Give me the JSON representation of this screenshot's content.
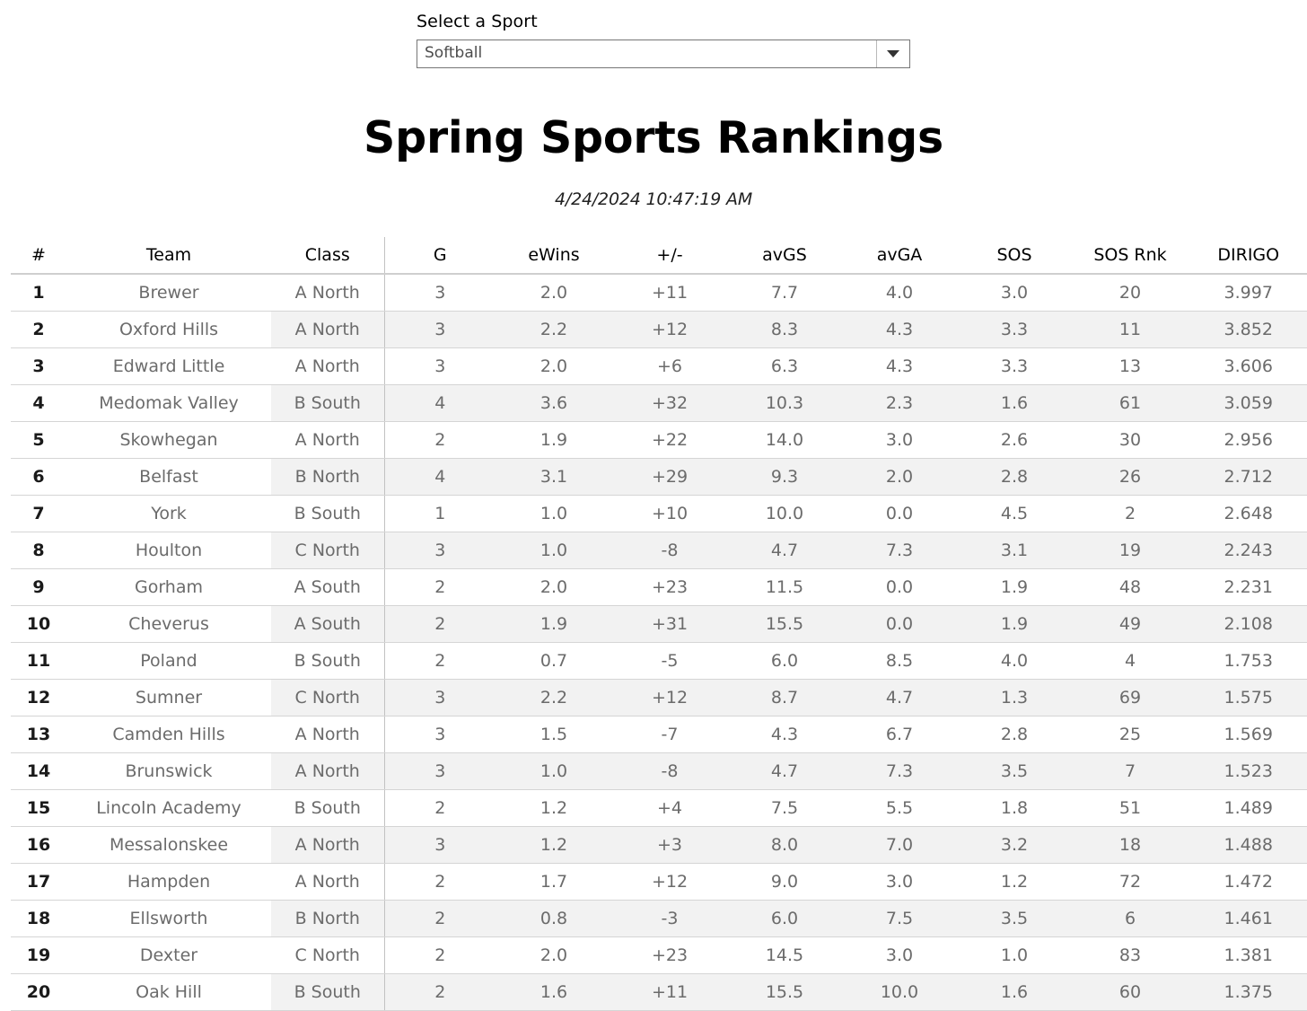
{
  "selector": {
    "label": "Select a Sport",
    "value": "Softball",
    "placeholder": "Select a Sport",
    "arrow_icon": "chevron-down-icon"
  },
  "report": {
    "title": "Spring Sports Rankings",
    "timestamp": "4/24/2024 10:47:19 AM"
  },
  "table": {
    "columns": [
      "#",
      "Team",
      "Class",
      "G",
      "eWins",
      "+/-",
      "avGS",
      "avGA",
      "SOS",
      "SOS Rnk",
      "DIRIGO"
    ],
    "rows": [
      {
        "rank": "1",
        "team": "Brewer",
        "class": "A North",
        "g": "3",
        "ewins": "2.0",
        "pm": "+11",
        "avgs": "7.7",
        "avga": "4.0",
        "sos": "3.0",
        "sosrnk": "20",
        "dirigo": "3.997"
      },
      {
        "rank": "2",
        "team": "Oxford Hills",
        "class": "A North",
        "g": "3",
        "ewins": "2.2",
        "pm": "+12",
        "avgs": "8.3",
        "avga": "4.3",
        "sos": "3.3",
        "sosrnk": "11",
        "dirigo": "3.852"
      },
      {
        "rank": "3",
        "team": "Edward Little",
        "class": "A North",
        "g": "3",
        "ewins": "2.0",
        "pm": "+6",
        "avgs": "6.3",
        "avga": "4.3",
        "sos": "3.3",
        "sosrnk": "13",
        "dirigo": "3.606"
      },
      {
        "rank": "4",
        "team": "Medomak Valley",
        "class": "B South",
        "g": "4",
        "ewins": "3.6",
        "pm": "+32",
        "avgs": "10.3",
        "avga": "2.3",
        "sos": "1.6",
        "sosrnk": "61",
        "dirigo": "3.059"
      },
      {
        "rank": "5",
        "team": "Skowhegan",
        "class": "A North",
        "g": "2",
        "ewins": "1.9",
        "pm": "+22",
        "avgs": "14.0",
        "avga": "3.0",
        "sos": "2.6",
        "sosrnk": "30",
        "dirigo": "2.956"
      },
      {
        "rank": "6",
        "team": "Belfast",
        "class": "B North",
        "g": "4",
        "ewins": "3.1",
        "pm": "+29",
        "avgs": "9.3",
        "avga": "2.0",
        "sos": "2.8",
        "sosrnk": "26",
        "dirigo": "2.712"
      },
      {
        "rank": "7",
        "team": "York",
        "class": "B South",
        "g": "1",
        "ewins": "1.0",
        "pm": "+10",
        "avgs": "10.0",
        "avga": "0.0",
        "sos": "4.5",
        "sosrnk": "2",
        "dirigo": "2.648"
      },
      {
        "rank": "8",
        "team": "Houlton",
        "class": "C North",
        "g": "3",
        "ewins": "1.0",
        "pm": "-8",
        "avgs": "4.7",
        "avga": "7.3",
        "sos": "3.1",
        "sosrnk": "19",
        "dirigo": "2.243"
      },
      {
        "rank": "9",
        "team": "Gorham",
        "class": "A South",
        "g": "2",
        "ewins": "2.0",
        "pm": "+23",
        "avgs": "11.5",
        "avga": "0.0",
        "sos": "1.9",
        "sosrnk": "48",
        "dirigo": "2.231"
      },
      {
        "rank": "10",
        "team": "Cheverus",
        "class": "A South",
        "g": "2",
        "ewins": "1.9",
        "pm": "+31",
        "avgs": "15.5",
        "avga": "0.0",
        "sos": "1.9",
        "sosrnk": "49",
        "dirigo": "2.108"
      },
      {
        "rank": "11",
        "team": "Poland",
        "class": "B South",
        "g": "2",
        "ewins": "0.7",
        "pm": "-5",
        "avgs": "6.0",
        "avga": "8.5",
        "sos": "4.0",
        "sosrnk": "4",
        "dirigo": "1.753"
      },
      {
        "rank": "12",
        "team": "Sumner",
        "class": "C North",
        "g": "3",
        "ewins": "2.2",
        "pm": "+12",
        "avgs": "8.7",
        "avga": "4.7",
        "sos": "1.3",
        "sosrnk": "69",
        "dirigo": "1.575"
      },
      {
        "rank": "13",
        "team": "Camden Hills",
        "class": "A North",
        "g": "3",
        "ewins": "1.5",
        "pm": "-7",
        "avgs": "4.3",
        "avga": "6.7",
        "sos": "2.8",
        "sosrnk": "25",
        "dirigo": "1.569"
      },
      {
        "rank": "14",
        "team": "Brunswick",
        "class": "A North",
        "g": "3",
        "ewins": "1.0",
        "pm": "-8",
        "avgs": "4.7",
        "avga": "7.3",
        "sos": "3.5",
        "sosrnk": "7",
        "dirigo": "1.523"
      },
      {
        "rank": "15",
        "team": "Lincoln Academy",
        "class": "B South",
        "g": "2",
        "ewins": "1.2",
        "pm": "+4",
        "avgs": "7.5",
        "avga": "5.5",
        "sos": "1.8",
        "sosrnk": "51",
        "dirigo": "1.489"
      },
      {
        "rank": "16",
        "team": "Messalonskee",
        "class": "A North",
        "g": "3",
        "ewins": "1.2",
        "pm": "+3",
        "avgs": "8.0",
        "avga": "7.0",
        "sos": "3.2",
        "sosrnk": "18",
        "dirigo": "1.488"
      },
      {
        "rank": "17",
        "team": "Hampden",
        "class": "A North",
        "g": "2",
        "ewins": "1.7",
        "pm": "+12",
        "avgs": "9.0",
        "avga": "3.0",
        "sos": "1.2",
        "sosrnk": "72",
        "dirigo": "1.472"
      },
      {
        "rank": "18",
        "team": "Ellsworth",
        "class": "B North",
        "g": "2",
        "ewins": "0.8",
        "pm": "-3",
        "avgs": "6.0",
        "avga": "7.5",
        "sos": "3.5",
        "sosrnk": "6",
        "dirigo": "1.461"
      },
      {
        "rank": "19",
        "team": "Dexter",
        "class": "C North",
        "g": "2",
        "ewins": "2.0",
        "pm": "+23",
        "avgs": "14.5",
        "avga": "3.0",
        "sos": "1.0",
        "sosrnk": "83",
        "dirigo": "1.381"
      },
      {
        "rank": "20",
        "team": "Oak Hill",
        "class": "B South",
        "g": "2",
        "ewins": "1.6",
        "pm": "+11",
        "avgs": "15.5",
        "avga": "10.0",
        "sos": "1.6",
        "sosrnk": "60",
        "dirigo": "1.375"
      }
    ]
  },
  "colors": {
    "text_dark": "#1a1a1a",
    "text_gray": "#6b6b6b",
    "stripe": "#f2f2f2",
    "rule": "#d5d5d5",
    "border": "#767676"
  }
}
